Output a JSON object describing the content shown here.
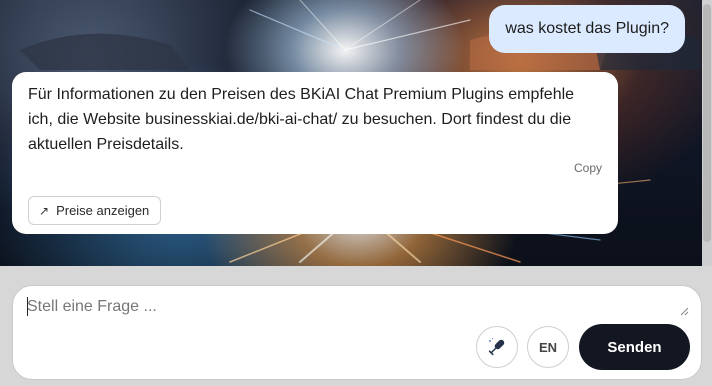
{
  "chat": {
    "user_message": "was kostet das Plugin?",
    "bot_message": "Für Informationen zu den Preisen des BKiAI Chat Premium Plugins empfehle ich, die Website businesskiai.de/bki-ai-chat/ zu besuchen. Dort findest du die aktuellen Preisdetails.",
    "copy_label": "Copy",
    "action_button": {
      "label": "Preise anzeigen",
      "icon": "arrow-up-right-icon"
    }
  },
  "composer": {
    "placeholder": "Stell eine Frage ...",
    "value": "",
    "mic_icon": "microphone-icon",
    "language_label": "EN",
    "send_label": "Senden"
  },
  "colors": {
    "user_bubble": "#dceaff",
    "bot_bubble": "#ffffff",
    "send_button": "#131722",
    "page_background": "#d7d7d7"
  }
}
